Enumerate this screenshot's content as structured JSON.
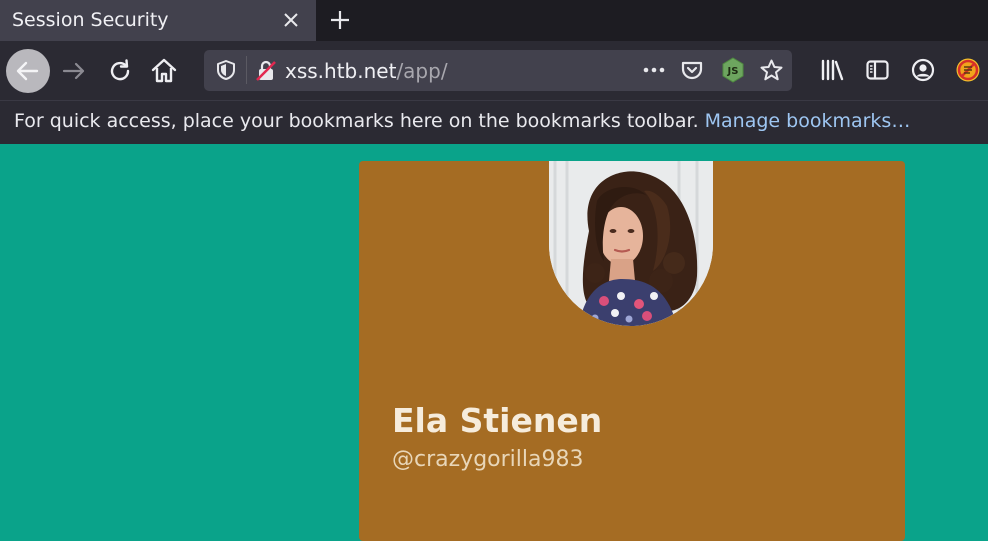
{
  "tab": {
    "title": "Session Security"
  },
  "urlbar": {
    "host": "xss.htb.net",
    "path": "/app/"
  },
  "bookmarks_bar": {
    "message": "For quick access, place your bookmarks here on the bookmarks toolbar.",
    "link": "Manage bookmarks…"
  },
  "profile": {
    "name": "Ela Stienen",
    "handle": "@crazygorilla983"
  },
  "colors": {
    "page_bg": "#0aa38a",
    "card_bg": "#a56c23",
    "tab_active": "#42414d",
    "toolbar": "#2b2a33",
    "link": "#9ec6f2"
  },
  "icons": [
    "close-icon",
    "plus-icon",
    "arrow-left-icon",
    "arrow-right-icon",
    "reload-icon",
    "home-icon",
    "shield-icon",
    "insecure-lock-icon",
    "more-icon",
    "pocket-icon",
    "nodejs-icon",
    "star-icon",
    "library-icon",
    "sidebar-icon",
    "account-icon",
    "extension-icon"
  ]
}
